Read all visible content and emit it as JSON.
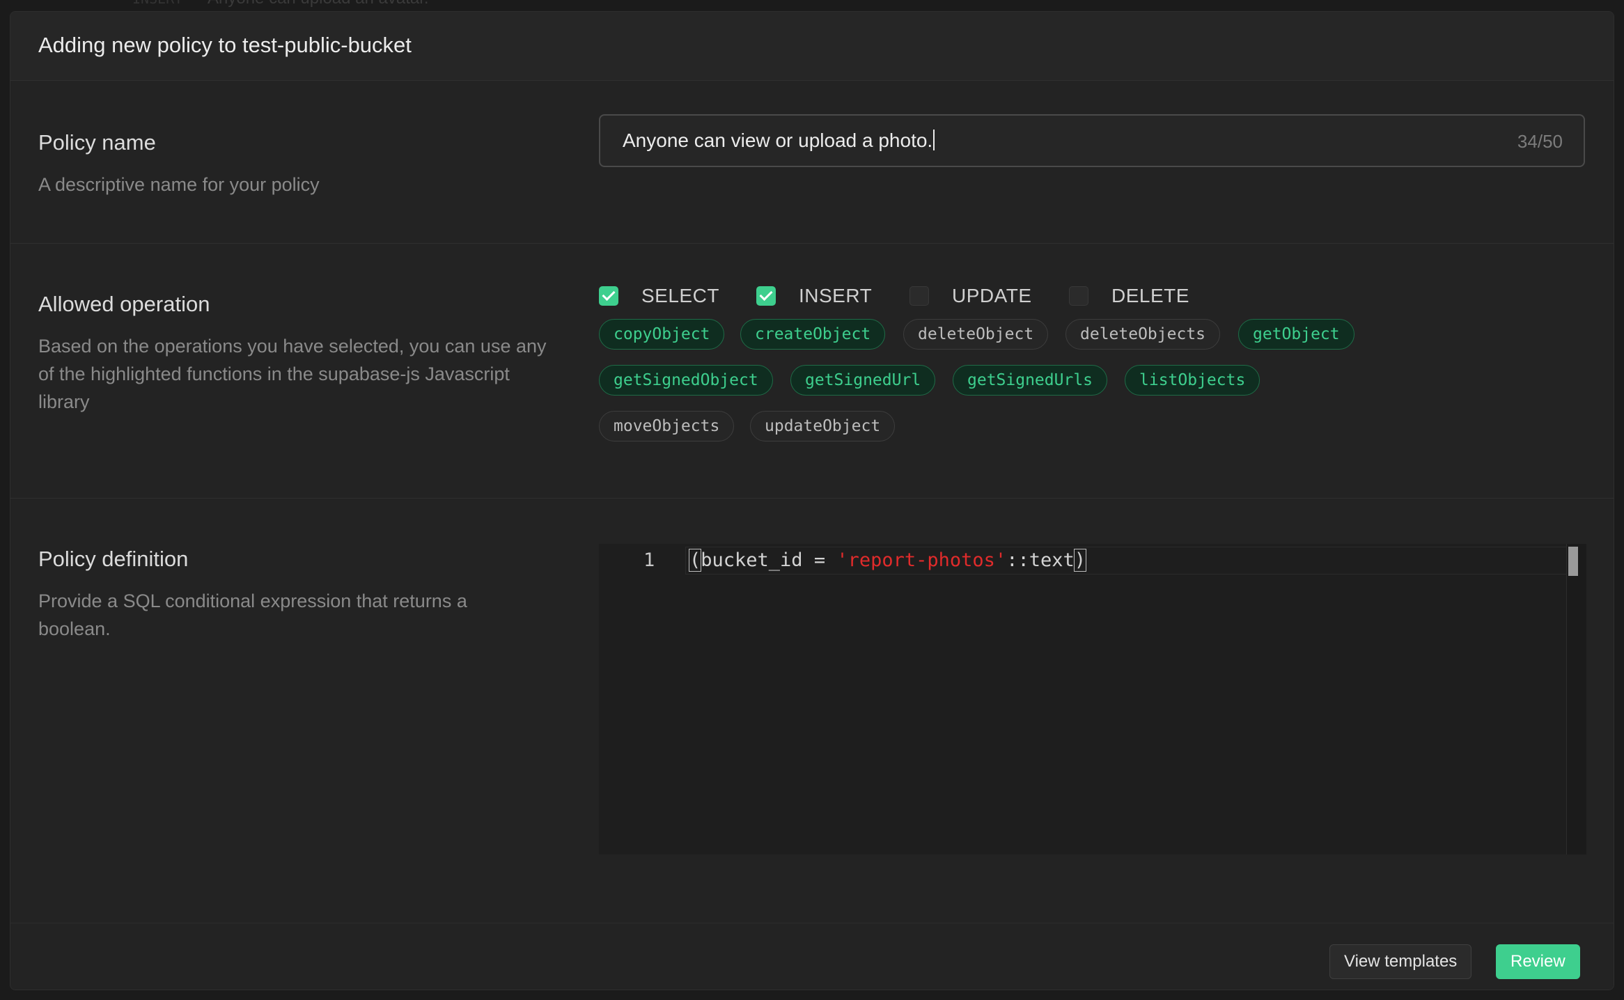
{
  "background": {
    "operation": "INSERT",
    "policy_name": "Anyone can upload an avatar."
  },
  "modal": {
    "title": "Adding new policy to test-public-bucket"
  },
  "policy_name": {
    "title": "Policy name",
    "description": "A descriptive name for your policy",
    "value": "Anyone can view or upload a photo.",
    "counter": "34/50"
  },
  "allowed_operation": {
    "title": "Allowed operation",
    "description": "Based on the operations you have selected, you can use any of the highlighted functions in the supabase-js Javascript library",
    "operations": [
      {
        "label": "SELECT",
        "checked": true
      },
      {
        "label": "INSERT",
        "checked": true
      },
      {
        "label": "UPDATE",
        "checked": false
      },
      {
        "label": "DELETE",
        "checked": false
      }
    ],
    "functions": [
      {
        "label": "copyObject",
        "highlighted": true
      },
      {
        "label": "createObject",
        "highlighted": true
      },
      {
        "label": "deleteObject",
        "highlighted": false
      },
      {
        "label": "deleteObjects",
        "highlighted": false
      },
      {
        "label": "getObject",
        "highlighted": true
      },
      {
        "label": "getSignedObject",
        "highlighted": true
      },
      {
        "label": "getSignedUrl",
        "highlighted": true
      },
      {
        "label": "getSignedUrls",
        "highlighted": true
      },
      {
        "label": "listObjects",
        "highlighted": true
      },
      {
        "label": "moveObjects",
        "highlighted": false
      },
      {
        "label": "updateObject",
        "highlighted": false
      }
    ]
  },
  "policy_definition": {
    "title": "Policy definition",
    "description": "Provide a SQL conditional expression that returns a boolean.",
    "line_number": "1",
    "code": {
      "open_paren": "(",
      "part1": "bucket_id = ",
      "string": "'report-photos'",
      "part2": "::text",
      "close_paren": ")"
    }
  },
  "footer": {
    "view_templates_label": "View templates",
    "review_label": "Review"
  },
  "colors": {
    "accent": "#3ecf8e",
    "sql_string": "#e02b2b"
  }
}
